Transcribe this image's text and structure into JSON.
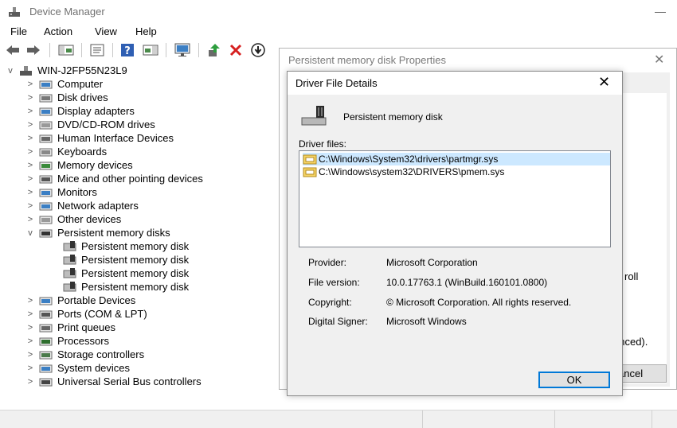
{
  "app": {
    "title": "Device Manager"
  },
  "menu": [
    "File",
    "Action",
    "View",
    "Help"
  ],
  "toolbar": {
    "icons": [
      "back-arrow-icon",
      "forward-arrow-icon",
      "show-hide-console-tree-icon",
      "properties-icon",
      "help-icon",
      "action-pane-icon",
      "monitor-icon",
      "update-driver-icon",
      "uninstall-device-icon",
      "disable-device-icon"
    ]
  },
  "tree": {
    "root": "WIN-J2FP55N23L9",
    "items": [
      {
        "label": "Computer",
        "icon": "computer-icon",
        "expander": ">"
      },
      {
        "label": "Disk drives",
        "icon": "disk-drive-icon",
        "expander": ">"
      },
      {
        "label": "Display adapters",
        "icon": "display-adapter-icon",
        "expander": ">"
      },
      {
        "label": "DVD/CD-ROM drives",
        "icon": "dvd-drive-icon",
        "expander": ">"
      },
      {
        "label": "Human Interface Devices",
        "icon": "hid-icon",
        "expander": ">"
      },
      {
        "label": "Keyboards",
        "icon": "keyboard-icon",
        "expander": ">"
      },
      {
        "label": "Memory devices",
        "icon": "memory-icon",
        "expander": ">"
      },
      {
        "label": "Mice and other pointing devices",
        "icon": "mouse-icon",
        "expander": ">"
      },
      {
        "label": "Monitors",
        "icon": "monitor-icon",
        "expander": ">"
      },
      {
        "label": "Network adapters",
        "icon": "network-adapter-icon",
        "expander": ">"
      },
      {
        "label": "Other devices",
        "icon": "unknown-device-icon",
        "expander": ">"
      },
      {
        "label": "Persistent memory disks",
        "icon": "persistent-memory-icon",
        "expander": "v"
      }
    ],
    "children": [
      "Persistent memory disk",
      "Persistent memory disk",
      "Persistent memory disk",
      "Persistent memory disk"
    ],
    "items_after": [
      {
        "label": "Portable Devices",
        "icon": "portable-device-icon",
        "expander": ">"
      },
      {
        "label": "Ports (COM & LPT)",
        "icon": "port-icon",
        "expander": ">"
      },
      {
        "label": "Print queues",
        "icon": "printer-icon",
        "expander": ">"
      },
      {
        "label": "Processors",
        "icon": "processor-icon",
        "expander": ">"
      },
      {
        "label": "Storage controllers",
        "icon": "storage-controller-icon",
        "expander": ">"
      },
      {
        "label": "System devices",
        "icon": "system-device-icon",
        "expander": ">"
      },
      {
        "label": "Universal Serial Bus controllers",
        "icon": "usb-icon",
        "expander": ">"
      }
    ]
  },
  "properties_dialog": {
    "title": "Persistent memory disk Properties",
    "partial_texts": {
      "roll": "roll",
      "anced": "anced).",
      "cancel": "ancel"
    }
  },
  "driver_dialog": {
    "title": "Driver File Details",
    "device_name": "Persistent memory disk",
    "driver_files_label": "Driver files:",
    "files": [
      "C:\\Windows\\System32\\drivers\\partmgr.sys",
      "C:\\Windows\\system32\\DRIVERS\\pmem.sys"
    ],
    "provider_label": "Provider:",
    "provider": "Microsoft Corporation",
    "file_version_label": "File version:",
    "file_version": "10.0.17763.1 (WinBuild.160101.0800)",
    "copyright_label": "Copyright:",
    "copyright": "© Microsoft Corporation. All rights reserved.",
    "signer_label": "Digital Signer:",
    "signer": "Microsoft Windows",
    "ok_label": "OK"
  },
  "colors": {
    "selection": "#cce8ff",
    "focus_border": "#0078d7",
    "dialog_bg": "#f0f0f0"
  }
}
